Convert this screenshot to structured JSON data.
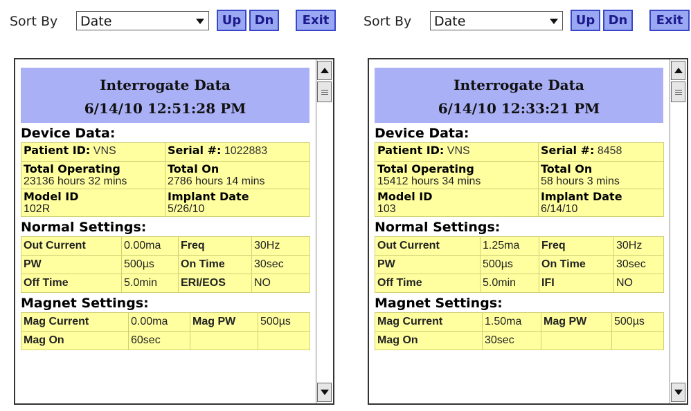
{
  "screens": [
    {
      "toolbar": {
        "sort_label": "Sort By",
        "sort_value": "Date",
        "up_label": "Up",
        "dn_label": "Dn",
        "exit_label": "Exit"
      },
      "header": {
        "title": "Interrogate Data",
        "datetime": "6/14/10 12:51:28 PM"
      },
      "device_data": {
        "title": "Device Data:",
        "patient_id_label": "Patient ID:",
        "patient_id_value": "VNS",
        "serial_label": "Serial #:",
        "serial_value": "1022883",
        "total_operating_label": "Total Operating",
        "total_operating_value": "23136 hours 32 mins",
        "total_on_label": "Total On",
        "total_on_value": "2786 hours 14 mins",
        "model_id_label": "Model ID",
        "model_id_value": "102R",
        "implant_date_label": "Implant Date",
        "implant_date_value": "5/26/10"
      },
      "normal_settings": {
        "title": "Normal Settings:",
        "rows": [
          [
            "Out Current",
            "0.00ma",
            "Freq",
            "30Hz"
          ],
          [
            "PW",
            "500µs",
            "On Time",
            "30sec"
          ],
          [
            "Off Time",
            "5.0min",
            "ERI/EOS",
            "NO"
          ]
        ]
      },
      "magnet_settings": {
        "title": "Magnet Settings:",
        "rows": [
          [
            "Mag Current",
            "0.00ma",
            "Mag PW",
            "500µs"
          ],
          [
            "Mag On",
            "60sec",
            "",
            ""
          ]
        ]
      }
    },
    {
      "toolbar": {
        "sort_label": "Sort By",
        "sort_value": "Date",
        "up_label": "Up",
        "dn_label": "Dn",
        "exit_label": "Exit"
      },
      "header": {
        "title": "Interrogate Data",
        "datetime": "6/14/10 12:33:21 PM"
      },
      "device_data": {
        "title": "Device Data:",
        "patient_id_label": "Patient ID:",
        "patient_id_value": "VNS",
        "serial_label": "Serial #:",
        "serial_value": "8458",
        "total_operating_label": "Total Operating",
        "total_operating_value": "15412 hours 34 mins",
        "total_on_label": "Total On",
        "total_on_value": "58 hours 3 mins",
        "model_id_label": "Model ID",
        "model_id_value": "103",
        "implant_date_label": "Implant Date",
        "implant_date_value": "6/14/10"
      },
      "normal_settings": {
        "title": "Normal Settings:",
        "rows": [
          [
            "Out Current",
            "1.25ma",
            "Freq",
            "30Hz"
          ],
          [
            "PW",
            "500µs",
            "On Time",
            "30sec"
          ],
          [
            "Off Time",
            "5.0min",
            "IFI",
            "NO"
          ]
        ]
      },
      "magnet_settings": {
        "title": "Magnet Settings:",
        "rows": [
          [
            "Mag Current",
            "1.50ma",
            "Mag PW",
            "500µs"
          ],
          [
            "Mag On",
            "30sec",
            "",
            ""
          ]
        ]
      }
    }
  ],
  "colors": {
    "header_bg": "#aab0f6",
    "table_bg": "#ffffa0",
    "button_bg": "#9aa7f2",
    "button_border": "#3847c9",
    "button_text": "#1a1a8c"
  }
}
